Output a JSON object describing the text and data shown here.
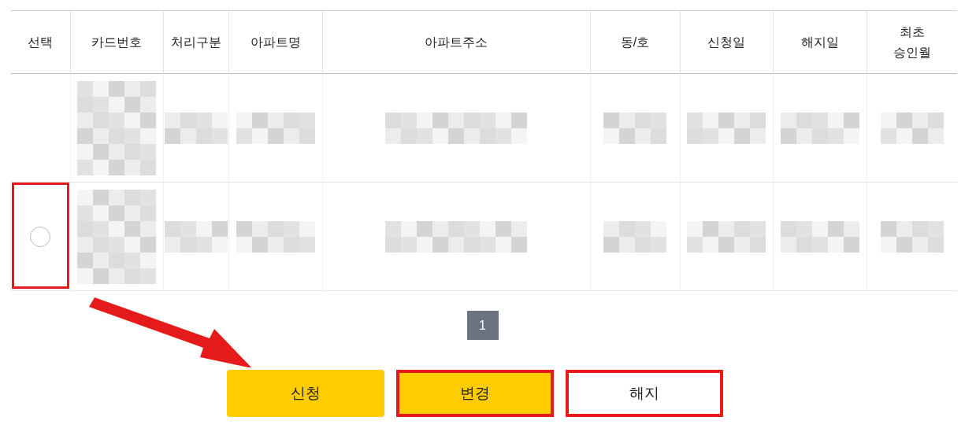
{
  "table": {
    "columns": [
      {
        "label": "선택"
      },
      {
        "label": "카드번호"
      },
      {
        "label": "처리구분"
      },
      {
        "label": "아파트명"
      },
      {
        "label": "아파트주소"
      },
      {
        "label": "동/호"
      },
      {
        "label": "신청일"
      },
      {
        "label": "해지일"
      },
      {
        "label": "최초\n승인월"
      }
    ],
    "rows": [
      {
        "kind": "plain"
      },
      {
        "kind": "selectable",
        "selected": false,
        "highlighted": true
      }
    ]
  },
  "pagination": [
    {
      "label": "1",
      "selected": true
    }
  ],
  "buttons": [
    {
      "label": "신청",
      "kind": "primary",
      "highlighted": false
    },
    {
      "label": "변경",
      "kind": "primary",
      "highlighted": true
    },
    {
      "label": "해지",
      "kind": "secondary",
      "highlighted": true
    }
  ]
}
